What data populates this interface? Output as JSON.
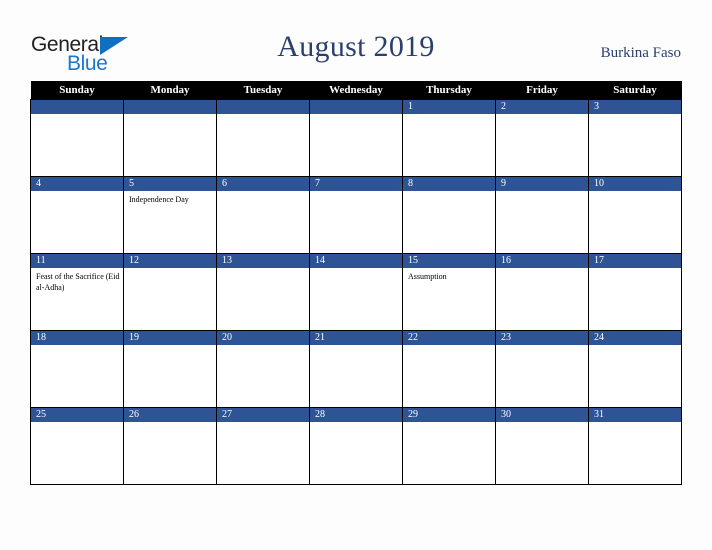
{
  "brand": {
    "logo_line1": "General",
    "logo_line2": "Blue",
    "triangle_icon": "blue-triangle-icon"
  },
  "header": {
    "title": "August 2019",
    "country": "Burkina Faso"
  },
  "colors": {
    "header_bar": "#000000",
    "date_bar": "#2e5496",
    "title_text": "#2b3f6b",
    "logo_blue": "#1b79c9",
    "page_background": "#fdfdfd",
    "cell_background": "#ffffff",
    "grid_border": "#000000"
  },
  "calendar": {
    "month": "August",
    "year": "2019",
    "weekday_headers": [
      "Sunday",
      "Monday",
      "Tuesday",
      "Wednesday",
      "Thursday",
      "Friday",
      "Saturday"
    ],
    "weeks": [
      [
        {
          "day": "",
          "events": []
        },
        {
          "day": "",
          "events": []
        },
        {
          "day": "",
          "events": []
        },
        {
          "day": "",
          "events": []
        },
        {
          "day": "1",
          "events": []
        },
        {
          "day": "2",
          "events": []
        },
        {
          "day": "3",
          "events": []
        }
      ],
      [
        {
          "day": "4",
          "events": []
        },
        {
          "day": "5",
          "events": [
            "Independence Day"
          ]
        },
        {
          "day": "6",
          "events": []
        },
        {
          "day": "7",
          "events": []
        },
        {
          "day": "8",
          "events": []
        },
        {
          "day": "9",
          "events": []
        },
        {
          "day": "10",
          "events": []
        }
      ],
      [
        {
          "day": "11",
          "events": [
            "Feast of the Sacrifice (Eid al-Adha)"
          ]
        },
        {
          "day": "12",
          "events": []
        },
        {
          "day": "13",
          "events": []
        },
        {
          "day": "14",
          "events": []
        },
        {
          "day": "15",
          "events": [
            "Assumption"
          ]
        },
        {
          "day": "16",
          "events": []
        },
        {
          "day": "17",
          "events": []
        }
      ],
      [
        {
          "day": "18",
          "events": []
        },
        {
          "day": "19",
          "events": []
        },
        {
          "day": "20",
          "events": []
        },
        {
          "day": "21",
          "events": []
        },
        {
          "day": "22",
          "events": []
        },
        {
          "day": "23",
          "events": []
        },
        {
          "day": "24",
          "events": []
        }
      ],
      [
        {
          "day": "25",
          "events": []
        },
        {
          "day": "26",
          "events": []
        },
        {
          "day": "27",
          "events": []
        },
        {
          "day": "28",
          "events": []
        },
        {
          "day": "29",
          "events": []
        },
        {
          "day": "30",
          "events": []
        },
        {
          "day": "31",
          "events": []
        }
      ]
    ]
  }
}
